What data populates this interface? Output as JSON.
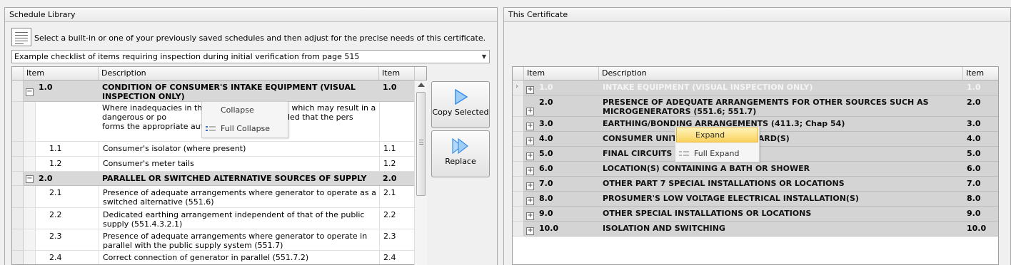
{
  "left_panel": {
    "title": "Schedule Library",
    "instruction": "Select a built-in or one of your previously saved schedules and then adjust for the precise needs of this certificate.",
    "combo_value": "Example checklist of items requiring inspection during initial verification from page 515",
    "icons": {
      "library": "book-list-icon",
      "dropdown": "chevron-down-icon"
    },
    "columns": [
      "Item",
      "Description",
      "Item"
    ],
    "rows": [
      {
        "item": "1.0",
        "desc": "CONDITION OF CONSUMER'S INTAKE EQUIPMENT (VISUAL INSPECTION ONLY)",
        "item2": "1.0"
      },
      {
        "item": "",
        "desc": "Where inadequacies in the i              countered, which may result in a dangerous or po              ation, it is recommended that the pers              forms the appropriate authority.",
        "item2": ""
      },
      {
        "item": "1.1",
        "desc": "Consumer's isolator (where present)",
        "item2": "1.1"
      },
      {
        "item": "1.2",
        "desc": "Consumer's meter tails",
        "item2": "1.2"
      },
      {
        "item": "2.0",
        "desc": "PARALLEL OR SWITCHED ALTERNATIVE SOURCES OF SUPPLY",
        "item2": "2.0"
      },
      {
        "item": "2.1",
        "desc": "Presence of adequate arrangements where generator to operate as a switched alternative (551.6)",
        "item2": "2.1"
      },
      {
        "item": "2.2",
        "desc": "Dedicated earthing arrangement independent of that of the public supply (551.4.3.2.1)",
        "item2": "2.2"
      },
      {
        "item": "2.3",
        "desc": "Presence of adequate arrangements where generator to operate in parallel with the public supply system (551.7)",
        "item2": "2.3"
      },
      {
        "item": "2.4",
        "desc": "Correct connection of generator in parallel (551.7.2)",
        "item2": "2.4"
      }
    ],
    "context_menu": [
      "Collapse",
      "Full Collapse"
    ]
  },
  "buttons": {
    "copy": "Copy Selected",
    "replace": "Replace"
  },
  "right_panel": {
    "title": "This Certificate",
    "columns": [
      "Item",
      "Description",
      "Item"
    ],
    "rows": [
      {
        "item": "1.0",
        "desc": "INTAKE EQUIPMENT (VISUAL INSPECTION ONLY)",
        "item2": "1.0"
      },
      {
        "item": "2.0",
        "desc": "PRESENCE OF ADEQUATE ARRANGEMENTS FOR OTHER SOURCES SUCH AS MICROGENERATORS (551.6; 551.7)",
        "item2": "2.0"
      },
      {
        "item": "3.0",
        "desc": "EARTHING/BONDING ARRANGEMENTS (411.3; Chap 54)",
        "item2": "3.0"
      },
      {
        "item": "4.0",
        "desc": "CONSUMER UNIT(                          DARD(S)",
        "item2": "4.0"
      },
      {
        "item": "5.0",
        "desc": "FINAL CIRCUITS",
        "item2": "5.0"
      },
      {
        "item": "6.0",
        "desc": "LOCATION(S) CONTAINING A BATH OR SHOWER",
        "item2": "6.0"
      },
      {
        "item": "7.0",
        "desc": "OTHER PART 7 SPECIAL INSTALLATIONS OR LOCATIONS",
        "item2": "7.0"
      },
      {
        "item": "8.0",
        "desc": "PROSUMER'S LOW VOLTAGE ELECTRICAL INSTALLATION(S)",
        "item2": "8.0"
      },
      {
        "item": "9.0",
        "desc": "OTHER SPECIAL INSTALLATIONS OR LOCATIONS",
        "item2": "9.0"
      },
      {
        "item": "10.0",
        "desc": "ISOLATION AND SWITCHING",
        "item2": "10.0"
      }
    ],
    "context_menu": [
      "Expand",
      "Full Expand"
    ]
  },
  "colors": {
    "highlight": "#f9d25e",
    "section_bg": "#d8d8d8",
    "arrow_blue": "#3a8ee6"
  }
}
